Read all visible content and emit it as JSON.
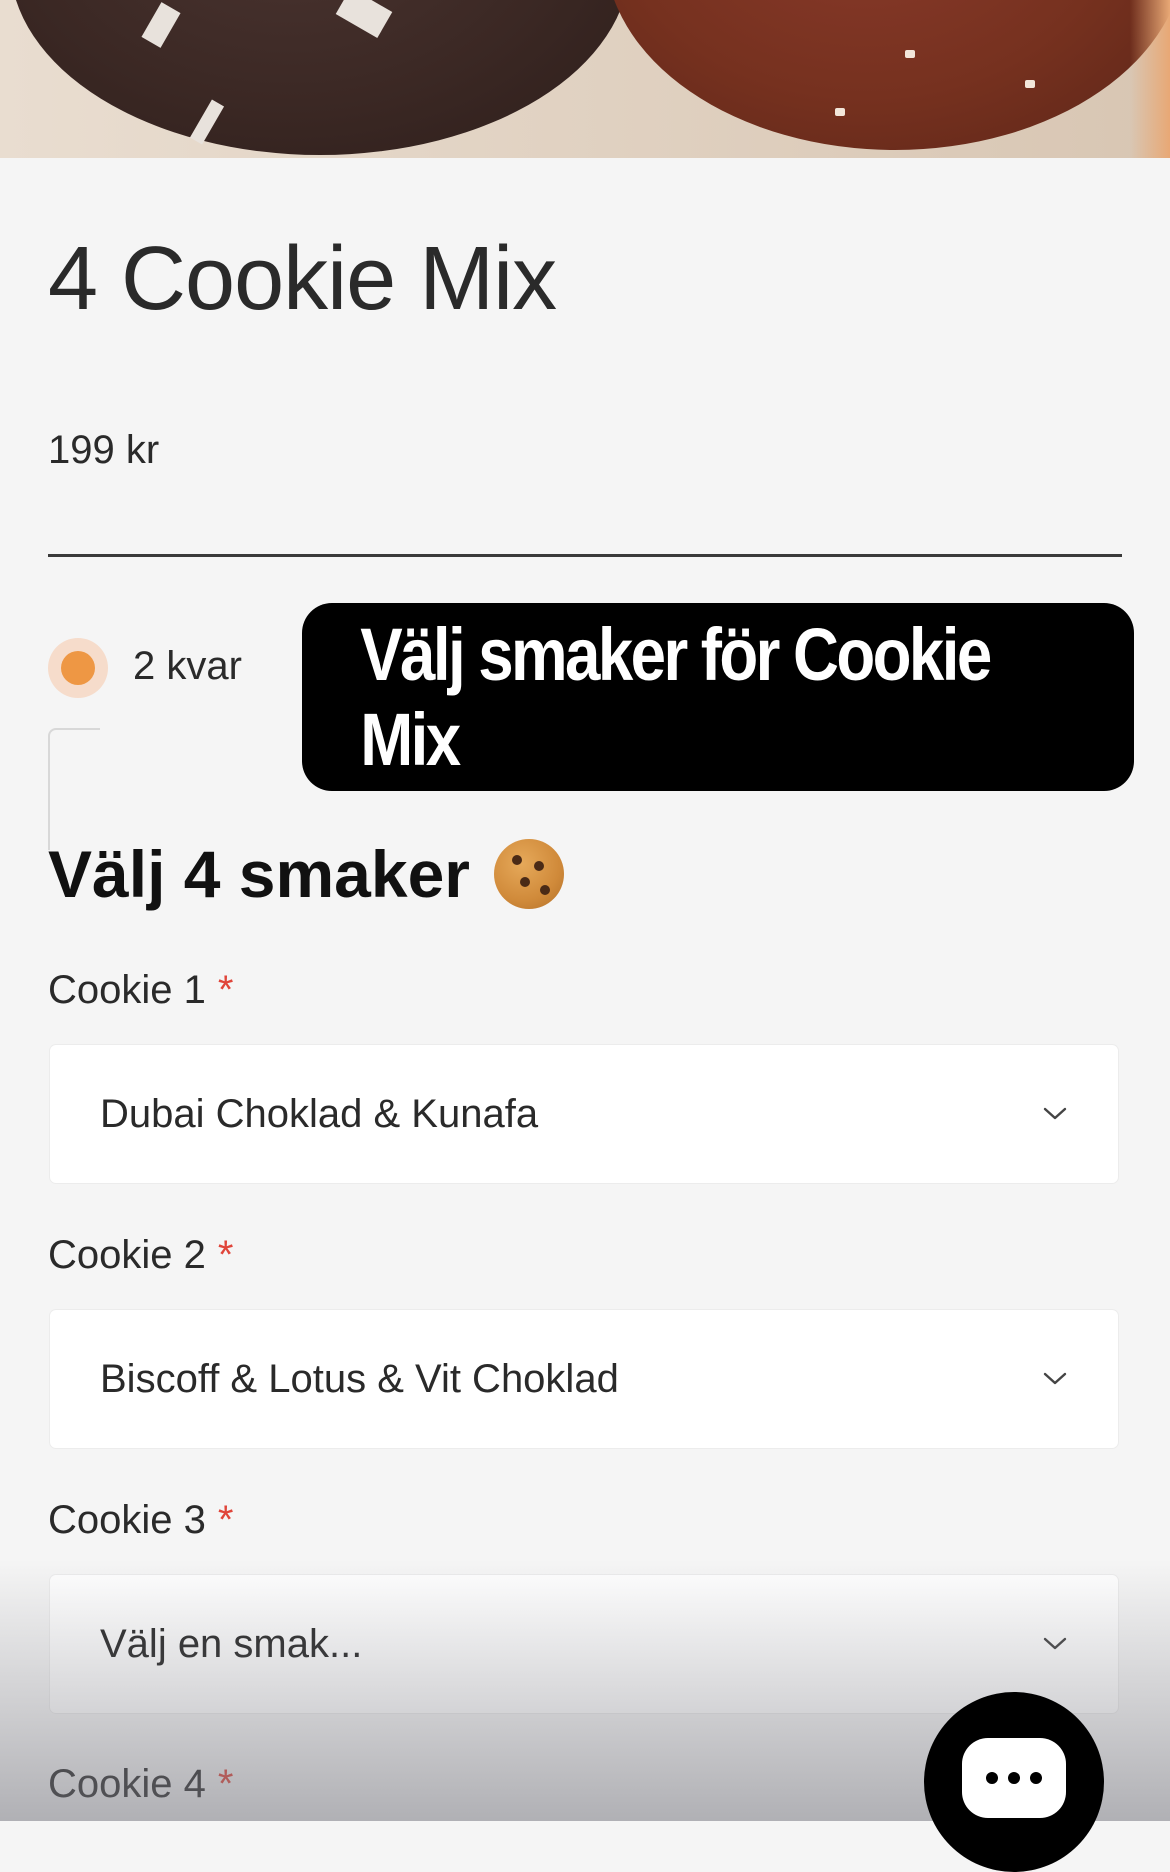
{
  "product": {
    "title": "4 Cookie Mix",
    "price": "199 kr",
    "stock": "2 kvar"
  },
  "overlay": {
    "banner_text": "Välj smaker för Cookie Mix"
  },
  "options": {
    "heading": "Välj 4 smaker",
    "required_mark": "*",
    "fields": [
      {
        "label": "Cookie 1",
        "value": "Dubai Choklad & Kunafa"
      },
      {
        "label": "Cookie 2",
        "value": "Biscoff & Lotus & Vit Choklad"
      },
      {
        "label": "Cookie 3",
        "value": "Välj en smak..."
      },
      {
        "label": "Cookie 4",
        "value": ""
      }
    ]
  },
  "colors": {
    "accent_orange": "#ee9744",
    "required_red": "#e0453a",
    "background": "#f5f5f5"
  },
  "icons": [
    "chevron-down-icon",
    "chat-icon",
    "cookie-emoji-icon"
  ]
}
